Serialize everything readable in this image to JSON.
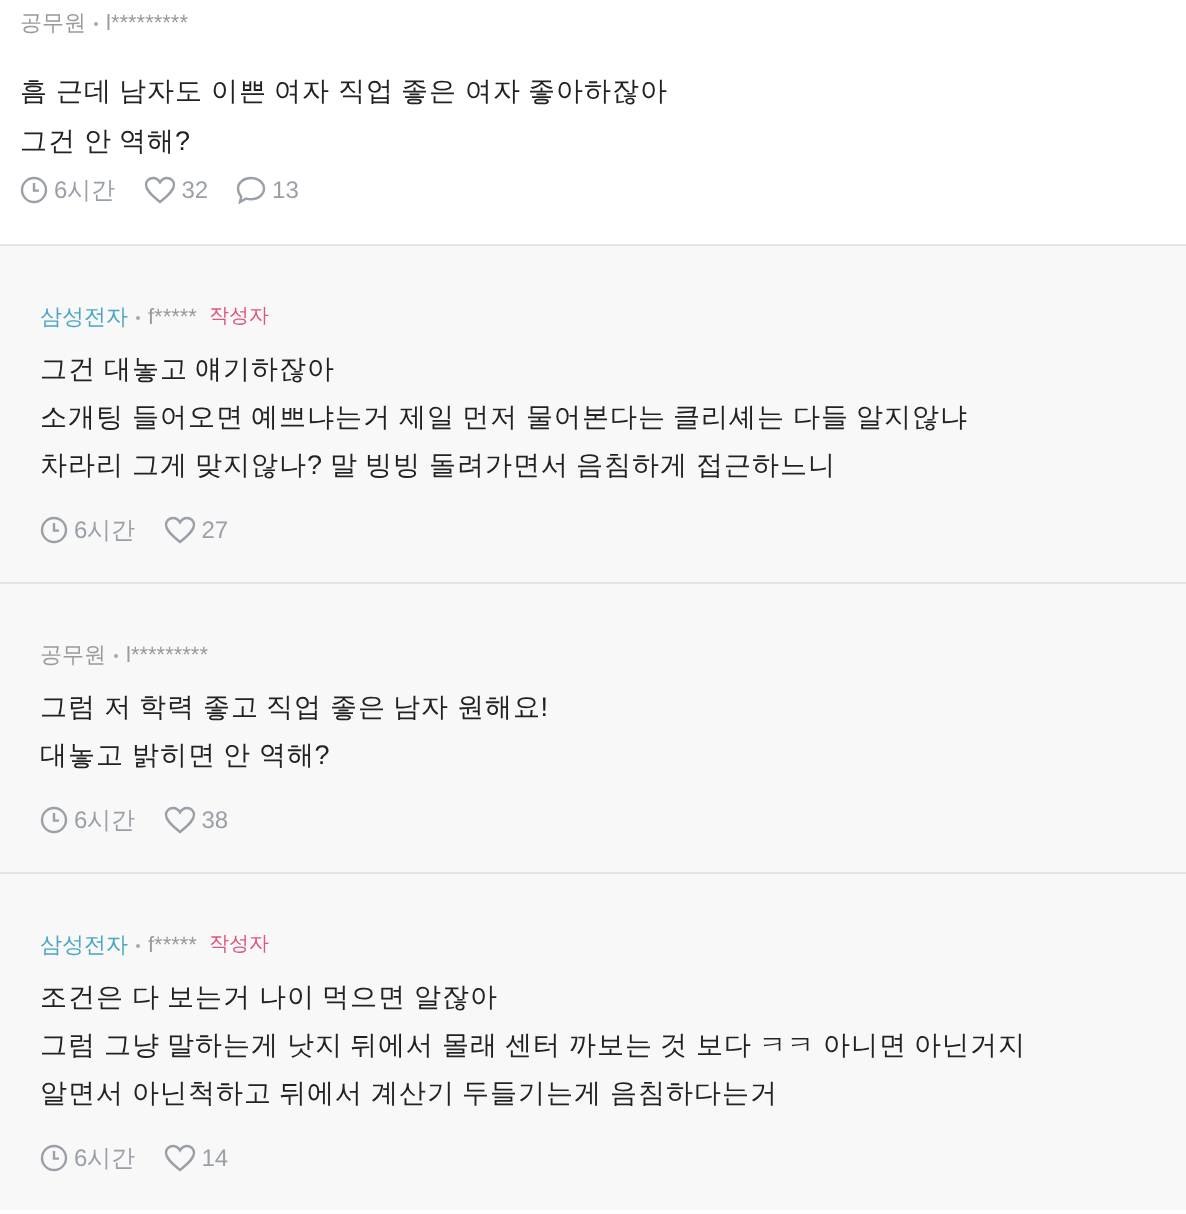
{
  "comments": [
    {
      "reply": false,
      "company": "공무원",
      "color": "#9a9a9a",
      "user": "l*********",
      "lines": [
        "흠 근데 남자도 이쁜 여자 직업 좋은 여자 좋아하잖아",
        "그건 안 역해?"
      ],
      "time": "6시간",
      "likes": "32",
      "comment_count": "13"
    },
    {
      "reply": true,
      "company": "삼성전자",
      "color": "#4ba6c4",
      "user": "f*****",
      "badge": "작성자",
      "lines": [
        "그건 대놓고 얘기하잖아",
        "소개팅 들어오면 예쁘냐는거 제일 먼저 물어본다는 클리셰는 다들 알지않냐",
        "차라리 그게 맞지않나? 말 빙빙 돌려가면서 음침하게 접근하느니"
      ],
      "time": "6시간",
      "likes": "27"
    },
    {
      "reply": true,
      "company": "공무원",
      "color": "#9a9a9a",
      "user": "l*********",
      "lines": [
        "그럼 저 학력 좋고 직업 좋은 남자 원해요!",
        "대놓고 밝히면 안 역해?"
      ],
      "time": "6시간",
      "likes": "38"
    },
    {
      "reply": true,
      "company": "삼성전자",
      "color": "#4ba6c4",
      "user": "f*****",
      "badge": "작성자",
      "lines": [
        "조건은 다 보는거 나이 먹으면 알잖아",
        "그럼 그냥 말하는게 낫지 뒤에서 몰래 센터 까보는 것 보다 ㅋㅋ 아니면 아닌거지",
        "알면서 아닌척하고 뒤에서 계산기 두들기는게 음침하다는거"
      ],
      "time": "6시간",
      "likes": "14"
    }
  ]
}
